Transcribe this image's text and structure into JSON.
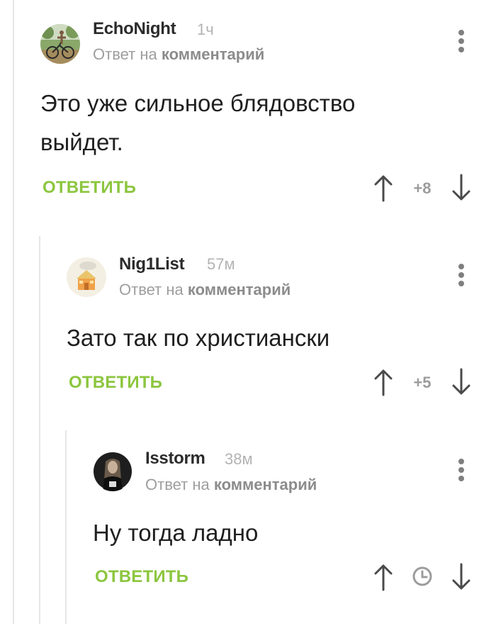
{
  "reply_prefix": "Ответ на",
  "reply_target": "комментарий",
  "reply_button_label": "ОТВЕТИТЬ",
  "accent_color": "#8cc63f",
  "comments": [
    {
      "author": "EchoNight",
      "time": "1ч",
      "body_lines": [
        "Это уже сильное блядовство",
        "выйдет."
      ],
      "rating": "+8",
      "avatar_icon": "cyclist-photo-avatar"
    },
    {
      "author": "Nig1List",
      "time": "57м",
      "body_lines": [
        "Зато так по христиански"
      ],
      "rating": "+5",
      "avatar_icon": "house-drawing-avatar"
    },
    {
      "author": "Isstorm",
      "time": "38м",
      "body_lines": [
        "Ну тогда ладно"
      ],
      "rating_icon": "clock-icon",
      "avatar_icon": "musician-photo-avatar"
    }
  ]
}
